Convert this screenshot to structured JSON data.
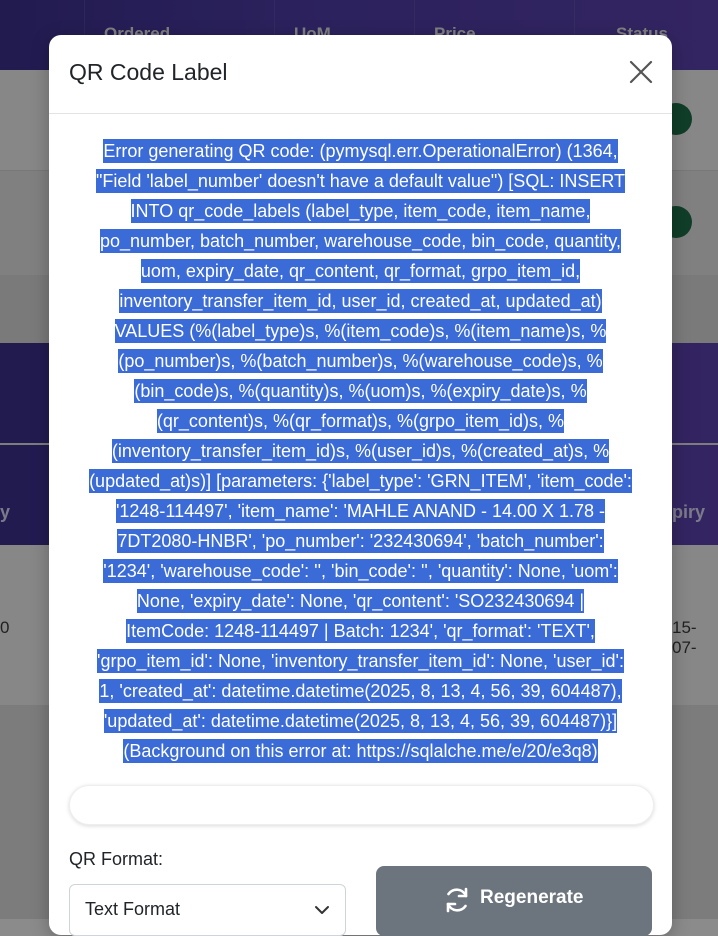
{
  "background": {
    "headers": [
      "Ordered",
      "UoM",
      "Price",
      "Status"
    ],
    "left_header_fragment": "y",
    "right_header_fragment": "piry",
    "left_cell_fragment": "0",
    "right_cell_fragment": "15-07-"
  },
  "modal": {
    "title": "QR Code Label",
    "error_lines": [
      "Error generating QR code: (pymysql.err.OperationalError) (1364,",
      "\"Field 'label_number' doesn't have a default value\") [SQL: INSERT",
      "INTO qr_code_labels (label_type, item_code, item_name,",
      "po_number, batch_number, warehouse_code, bin_code, quantity,",
      "uom, expiry_date, qr_content, qr_format, grpo_item_id,",
      "inventory_transfer_item_id, user_id, created_at, updated_at)",
      "VALUES (%(label_type)s, %(item_code)s, %(item_name)s, %",
      "(po_number)s, %(batch_number)s, %(warehouse_code)s, %",
      "(bin_code)s, %(quantity)s, %(uom)s, %(expiry_date)s, %",
      "(qr_content)s, %(qr_format)s, %(grpo_item_id)s, %",
      "(inventory_transfer_item_id)s, %(user_id)s, %(created_at)s, %",
      "(updated_at)s)] [parameters: {'label_type': 'GRN_ITEM', 'item_code':",
      "'1248-114497', 'item_name': 'MAHLE ANAND - 14.00 X 1.78 -",
      "7DT2080-HNBR', 'po_number': '232430694', 'batch_number':",
      "'1234', 'warehouse_code': '', 'bin_code': '', 'quantity': None, 'uom':",
      "None, 'expiry_date': None, 'qr_content': 'SO232430694 |",
      "ItemCode: 1248-114497 | Batch: 1234', 'qr_format': 'TEXT',",
      "'grpo_item_id': None, 'inventory_transfer_item_id': None, 'user_id':",
      "1, 'created_at': datetime.datetime(2025, 8, 13, 4, 56, 39, 604487),",
      "'updated_at': datetime.datetime(2025, 8, 13, 4, 56, 39, 604487)}]",
      "(Background on this error at: https://sqlalche.me/e/20/e3q8)"
    ],
    "qr_format_label": "QR Format:",
    "qr_format_value": "Text Format",
    "regenerate_label": "Regenerate",
    "colors": {
      "selection_highlight": "#3b6bd6",
      "regenerate_bg": "#6c757d",
      "header_purple": "#4b3aa0",
      "status_green": "#1d6b45"
    }
  }
}
